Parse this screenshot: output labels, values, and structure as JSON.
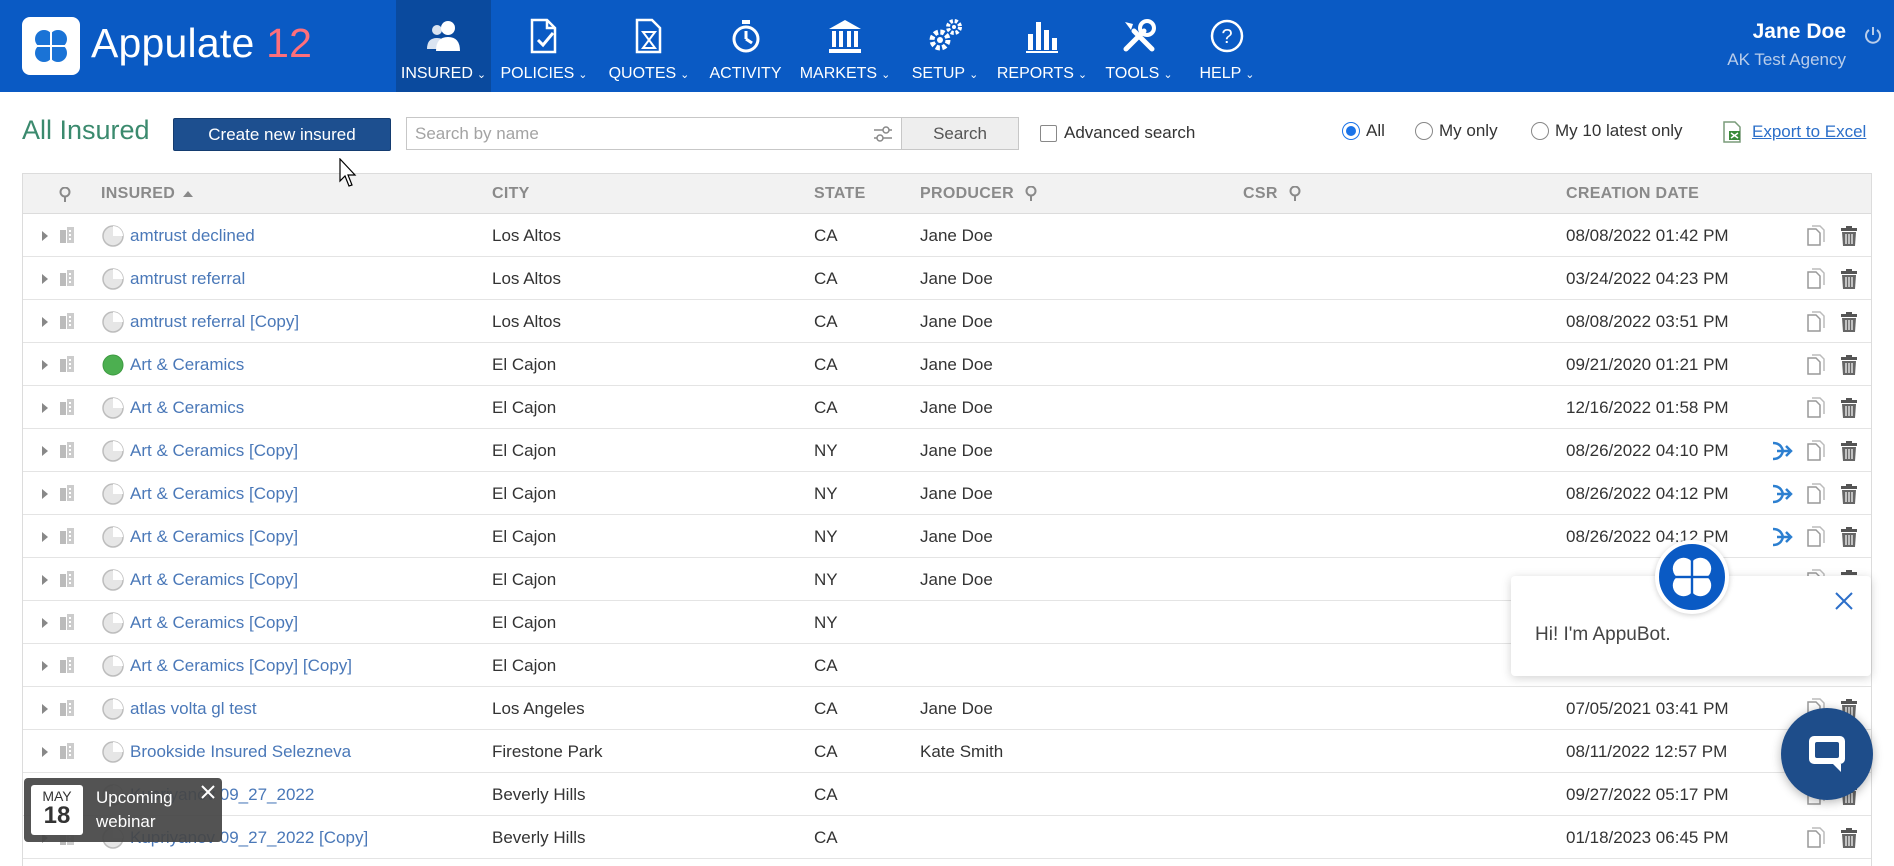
{
  "app": {
    "name": "Appulate",
    "version": "12"
  },
  "nav": [
    {
      "label": "INSURED",
      "icon": "users-icon",
      "dropdown": true,
      "active": true
    },
    {
      "label": "POLICIES",
      "icon": "policy-doc-icon",
      "dropdown": true
    },
    {
      "label": "QUOTES",
      "icon": "quote-hourglass-icon",
      "dropdown": true
    },
    {
      "label": "ACTIVITY",
      "icon": "stopwatch-icon",
      "dropdown": false
    },
    {
      "label": "MARKETS",
      "icon": "bank-building-icon",
      "dropdown": true
    },
    {
      "label": "SETUP",
      "icon": "gears-icon",
      "dropdown": true
    },
    {
      "label": "REPORTS",
      "icon": "bar-chart-icon",
      "dropdown": true
    },
    {
      "label": "TOOLS",
      "icon": "tools-icon",
      "dropdown": true
    },
    {
      "label": "HELP",
      "icon": "help-circle-icon",
      "dropdown": true
    }
  ],
  "user": {
    "name": "Jane Doe",
    "agency": "AK Test Agency"
  },
  "toolbar": {
    "title": "All Insured",
    "create_label": "Create new insured",
    "search_placeholder": "Search by name",
    "search_value": "",
    "search_button": "Search",
    "advanced_label": "Advanced search",
    "advanced_checked": false,
    "filters": [
      {
        "label": "All",
        "selected": true
      },
      {
        "label": "My only",
        "selected": false
      },
      {
        "label": "My 10 latest only",
        "selected": false
      }
    ],
    "export_label": "Export to Excel"
  },
  "table": {
    "columns": {
      "insured": "INSURED",
      "city": "CITY",
      "state": "STATE",
      "producer": "PRODUCER",
      "csr": "CSR",
      "created": "CREATION DATE"
    },
    "sort": {
      "column": "insured",
      "direction": "asc"
    },
    "rows": [
      {
        "name": "amtrust declined",
        "city": "Los Altos",
        "state": "CA",
        "producer": "Jane Doe",
        "csr": "",
        "date": "08/08/2022 01:42 PM",
        "status": "pending",
        "forward": false
      },
      {
        "name": "amtrust referral",
        "city": "Los Altos",
        "state": "CA",
        "producer": "Jane Doe",
        "csr": "",
        "date": "03/24/2022 04:23 PM",
        "status": "pending",
        "forward": false
      },
      {
        "name": "amtrust referral [Copy]",
        "city": "Los Altos",
        "state": "CA",
        "producer": "Jane Doe",
        "csr": "",
        "date": "08/08/2022 03:51 PM",
        "status": "pending",
        "forward": false
      },
      {
        "name": "Art & Ceramics",
        "city": "El Cajon",
        "state": "CA",
        "producer": "Jane Doe",
        "csr": "",
        "date": "09/21/2020 01:21 PM",
        "status": "complete",
        "forward": false
      },
      {
        "name": "Art & Ceramics",
        "city": "El Cajon",
        "state": "CA",
        "producer": "Jane Doe",
        "csr": "",
        "date": "12/16/2022 01:58 PM",
        "status": "pending",
        "forward": false
      },
      {
        "name": "Art & Ceramics [Copy]",
        "city": "El Cajon",
        "state": "NY",
        "producer": "Jane Doe",
        "csr": "",
        "date": "08/26/2022 04:10 PM",
        "status": "pending",
        "forward": true
      },
      {
        "name": "Art & Ceramics [Copy]",
        "city": "El Cajon",
        "state": "NY",
        "producer": "Jane Doe",
        "csr": "",
        "date": "08/26/2022 04:12 PM",
        "status": "pending",
        "forward": true
      },
      {
        "name": "Art & Ceramics [Copy]",
        "city": "El Cajon",
        "state": "NY",
        "producer": "Jane Doe",
        "csr": "",
        "date": "08/26/2022 04:12 PM",
        "status": "pending",
        "forward": true
      },
      {
        "name": "Art & Ceramics [Copy]",
        "city": "El Cajon",
        "state": "NY",
        "producer": "Jane Doe",
        "csr": "",
        "date": "",
        "status": "pending",
        "forward": false
      },
      {
        "name": "Art & Ceramics [Copy]",
        "city": "El Cajon",
        "state": "NY",
        "producer": "",
        "csr": "",
        "date": "",
        "status": "pending",
        "forward": false
      },
      {
        "name": "Art & Ceramics [Copy] [Copy]",
        "city": "El Cajon",
        "state": "CA",
        "producer": "",
        "csr": "",
        "date": "",
        "status": "pending",
        "forward": false
      },
      {
        "name": "atlas volta gl test",
        "city": "Los Angeles",
        "state": "CA",
        "producer": "Jane Doe",
        "csr": "",
        "date": "07/05/2021 03:41 PM",
        "status": "pending",
        "forward": false
      },
      {
        "name": "Brookside Insured Selezneva",
        "city": "Firestone Park",
        "state": "CA",
        "producer": "Kate Smith",
        "csr": "",
        "date": "08/11/2022 12:57 PM",
        "status": "pending",
        "forward": false
      },
      {
        "name": "Kupriyanov 09_27_2022",
        "city": "Beverly Hills",
        "state": "CA",
        "producer": "",
        "csr": "",
        "date": "09/27/2022 05:17 PM",
        "status": "pending",
        "forward": false
      },
      {
        "name": "Kupriyanov 09_27_2022 [Copy]",
        "city": "Beverly Hills",
        "state": "CA",
        "producer": "",
        "csr": "",
        "date": "01/18/2023 06:45 PM",
        "status": "pending",
        "forward": false
      }
    ]
  },
  "appubot": {
    "greeting": "Hi! I'm AppuBot."
  },
  "webinar": {
    "month": "MAY",
    "day": "18",
    "text_line1": "Upcoming",
    "text_line2": "webinar"
  },
  "colors": {
    "brand": "#0a5ac4",
    "title": "#3b8a6e",
    "link": "#4a78b8",
    "version": "#ff6f7b"
  }
}
